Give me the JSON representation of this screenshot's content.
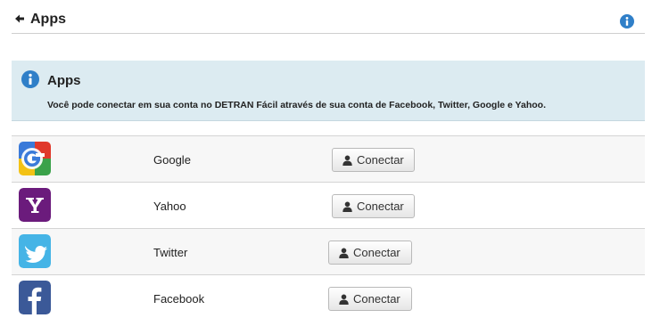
{
  "header": {
    "title": "Apps",
    "back_icon": "arrow-left-icon",
    "info_icon": "info-icon"
  },
  "info_panel": {
    "title": "Apps",
    "text": "Você pode conectar em sua conta no DETRAN Fácil através de sua conta de Facebook, Twitter, Google e Yahoo.",
    "icon": "info-icon"
  },
  "apps": [
    {
      "name": "Google",
      "button_label": "Conectar",
      "logo_icon": "google-logo-icon"
    },
    {
      "name": "Yahoo",
      "button_label": "Conectar",
      "logo_icon": "yahoo-logo-icon"
    },
    {
      "name": "Twitter",
      "button_label": "Conectar",
      "logo_icon": "twitter-logo-icon"
    },
    {
      "name": "Facebook",
      "button_label": "Conectar",
      "logo_icon": "facebook-logo-icon"
    }
  ],
  "colors": {
    "info_blue": "#2f7fc8",
    "panel_background": "#dcebf1",
    "yahoo_purple": "#6b1b7c",
    "twitter_blue": "#45b4e6",
    "facebook_blue": "#3b5998"
  }
}
